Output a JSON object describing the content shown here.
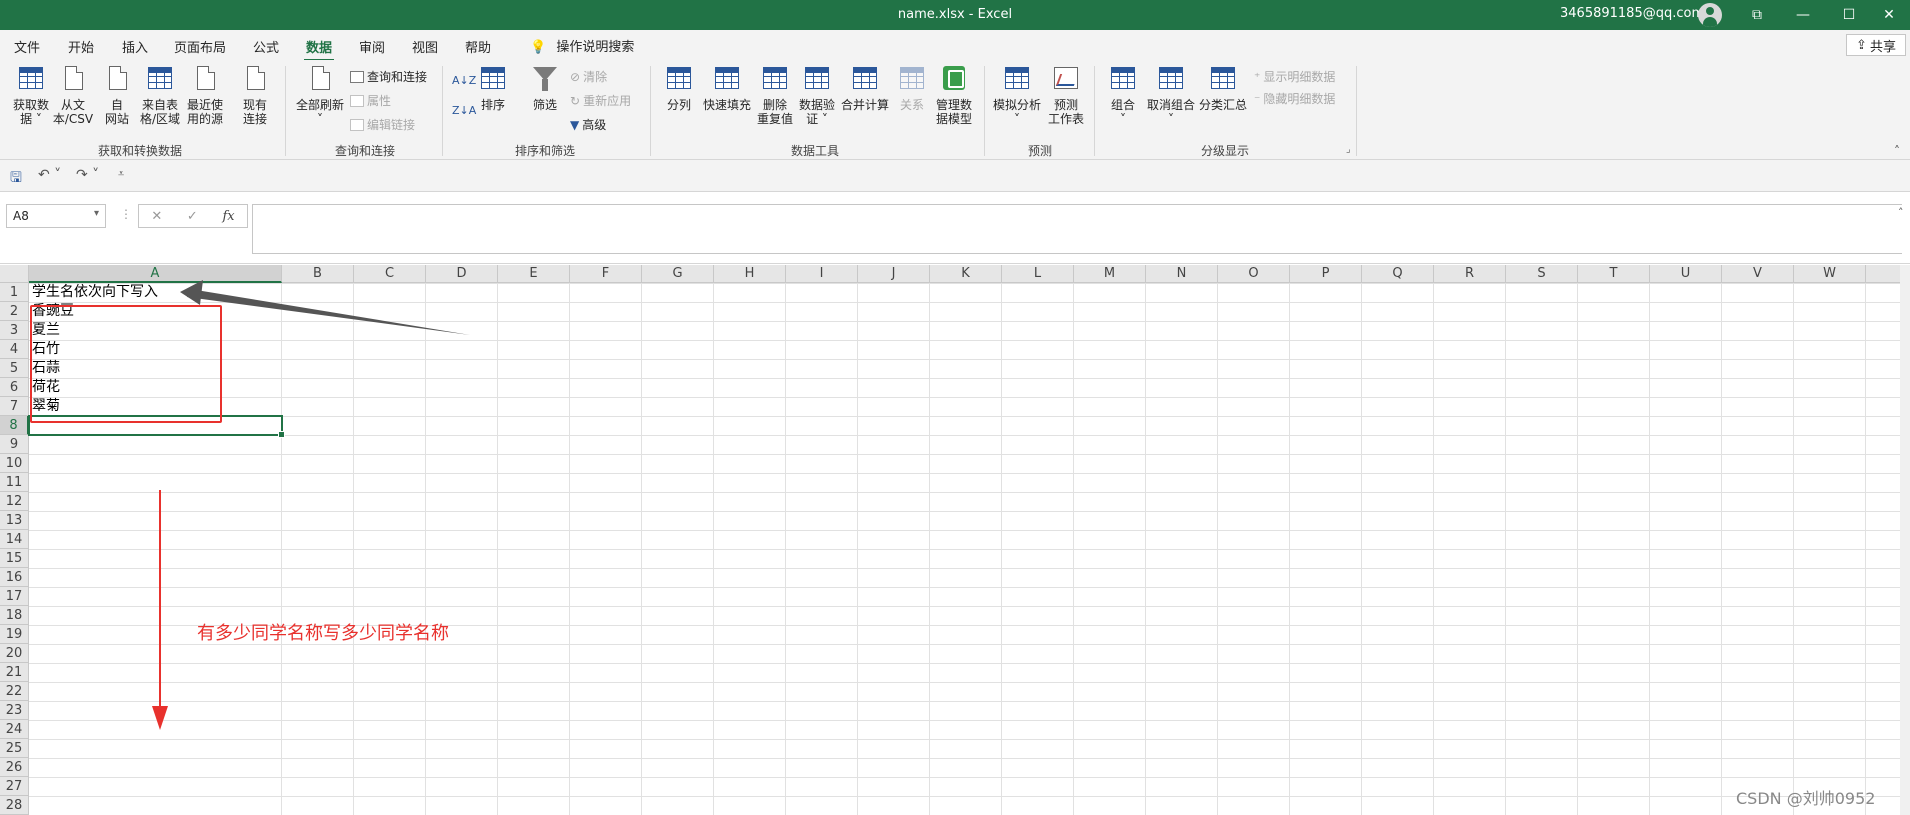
{
  "window": {
    "title": "name.xlsx  -  Excel",
    "account": "3465891185@qq.com",
    "controls": [
      "⧉",
      "—",
      "☐",
      "✕"
    ]
  },
  "menu": {
    "tabs": [
      "文件",
      "开始",
      "插入",
      "页面布局",
      "公式",
      "数据",
      "审阅",
      "视图",
      "帮助"
    ],
    "active": "数据",
    "search": "操作说明搜索",
    "share": "共享"
  },
  "ribbon": {
    "get_data": [
      "获取数",
      "据 ˅"
    ],
    "from_text": [
      "从文",
      "本/CSV"
    ],
    "from_web": [
      "自",
      "网站"
    ],
    "from_table": [
      "来自表",
      "格/区域"
    ],
    "recent_sources": [
      "最近使",
      "用的源"
    ],
    "existing_conn": [
      "现有",
      "连接"
    ],
    "group_get": "获取和转换数据",
    "refresh_all": [
      "全部刷新",
      "˅"
    ],
    "queries_conn": "查询和连接",
    "properties": "属性",
    "edit_links": "编辑链接",
    "group_queries": "查询和连接",
    "sort": "排序",
    "filter": "筛选",
    "clear": "清除",
    "reapply": "重新应用",
    "advanced": "高级",
    "group_sort": "排序和筛选",
    "text_to_cols": "分列",
    "flash_fill": "快速填充",
    "remove_dup": [
      "删除",
      "重复值"
    ],
    "validation": [
      "数据验",
      "证 ˅"
    ],
    "consolidate": "合并计算",
    "relationships": "关系",
    "data_model": [
      "管理数",
      "据模型"
    ],
    "group_tools": "数据工具",
    "what_if": [
      "模拟分析",
      "˅"
    ],
    "forecast": [
      "预测",
      "工作表"
    ],
    "group_forecast": "预测",
    "group_btn": [
      "组合",
      "˅"
    ],
    "ungroup": [
      "取消组合",
      "˅"
    ],
    "subtotal": "分类汇总",
    "show_detail": "显示明细数据",
    "hide_detail": "隐藏明细数据",
    "group_outline": "分级显示"
  },
  "formula": {
    "name_box": "A8",
    "fx": "fx",
    "cancel": "✕",
    "enter": "✓"
  },
  "sheet": {
    "columns": [
      "A",
      "B",
      "C",
      "D",
      "E",
      "F",
      "G",
      "H",
      "I",
      "J",
      "K",
      "L",
      "M",
      "N",
      "O",
      "P",
      "Q",
      "R",
      "S",
      "T",
      "U",
      "V",
      "W"
    ],
    "rows": [
      "1",
      "2",
      "3",
      "4",
      "5",
      "6",
      "7",
      "8",
      "9",
      "10",
      "11",
      "12",
      "13",
      "14",
      "15",
      "16",
      "17",
      "18",
      "19",
      "20",
      "21",
      "22",
      "23",
      "24",
      "25",
      "26",
      "27",
      "28"
    ],
    "cells": [
      "学生名依次向下写入",
      "香豌豆",
      "夏兰",
      "石竹",
      "石蒜",
      "荷花",
      "翠菊"
    ],
    "selected_col": "A",
    "selected_row": "8"
  },
  "annotation": "有多少同学名称写多少同学名称",
  "watermark": "CSDN @刘帅0952",
  "colors": {
    "excel_green": "#217346",
    "annotation_red": "#e8312d"
  }
}
